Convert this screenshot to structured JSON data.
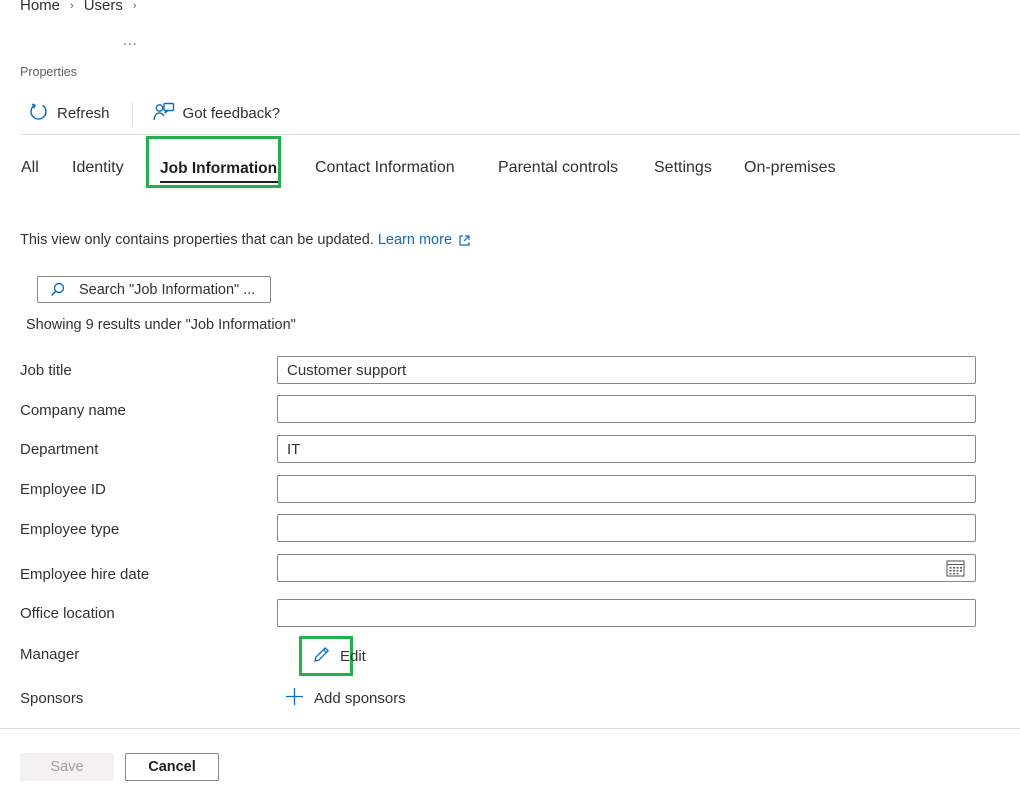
{
  "breadcrumb": {
    "items": [
      "Home",
      "Users"
    ],
    "separator": ">"
  },
  "header": {
    "ellipsis": "...",
    "subtitle": "Properties"
  },
  "commands": {
    "refresh": "Refresh",
    "feedback": "Got feedback?"
  },
  "tabs": [
    {
      "label": "All"
    },
    {
      "label": "Identity"
    },
    {
      "label": "Job Information",
      "active": true
    },
    {
      "label": "Contact Information"
    },
    {
      "label": "Parental controls"
    },
    {
      "label": "Settings"
    },
    {
      "label": "On-premises"
    }
  ],
  "info": {
    "text": "This view only contains properties that can be updated.",
    "link": "Learn more"
  },
  "search": {
    "placeholder": "Search \"Job Information\" ...",
    "results": "Showing 9 results under \"Job Information\""
  },
  "form": {
    "job_title": {
      "label": "Job title",
      "value": "Customer support"
    },
    "company_name": {
      "label": "Company name",
      "value": ""
    },
    "department": {
      "label": "Department",
      "value": "IT"
    },
    "employee_id": {
      "label": "Employee ID",
      "value": ""
    },
    "employee_type": {
      "label": "Employee type",
      "value": ""
    },
    "hire_date": {
      "label": "Employee hire date",
      "value": ""
    },
    "office_location": {
      "label": "Office location",
      "value": ""
    },
    "manager": {
      "label": "Manager",
      "action": "Edit"
    },
    "sponsors": {
      "label": "Sponsors",
      "action": "Add sponsors"
    }
  },
  "footer": {
    "save": "Save",
    "cancel": "Cancel"
  },
  "colors": {
    "highlight": "#22b14c",
    "link": "#0f6cbd",
    "border": "#8a8886"
  },
  "icons": {
    "refresh": "refresh-icon",
    "feedback": "feedback-icon",
    "search": "search-icon",
    "calendar": "calendar-icon",
    "edit": "pencil-icon",
    "add": "plus-icon",
    "external": "external-link-icon"
  }
}
